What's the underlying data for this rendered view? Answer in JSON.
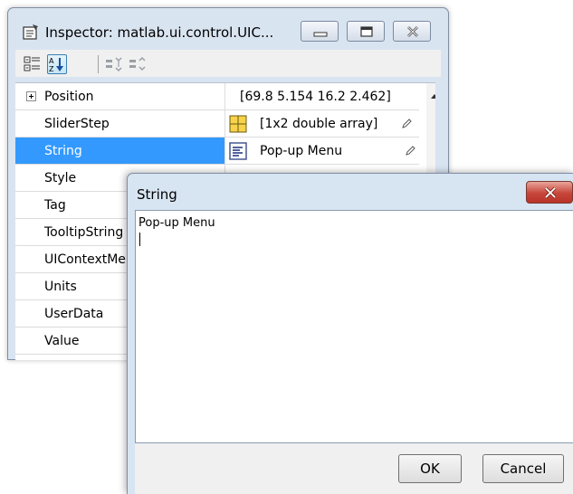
{
  "inspector": {
    "title": "Inspector:  matlab.ui.control.UIC...",
    "rows": [
      {
        "name": "Position",
        "value": "[69.8 5.154 16.2 2.462]"
      },
      {
        "name": "SliderStep",
        "value": "[1x2  double array]"
      },
      {
        "name": "String",
        "value": "Pop-up Menu"
      },
      {
        "name": "Style",
        "value": ""
      },
      {
        "name": "Tag",
        "value": ""
      },
      {
        "name": "TooltipString",
        "value": ""
      },
      {
        "name": "UIContextMenu",
        "value": ""
      },
      {
        "name": "Units",
        "value": ""
      },
      {
        "name": "UserData",
        "value": ""
      },
      {
        "name": "Value",
        "value": ""
      }
    ]
  },
  "dialog": {
    "title": "String",
    "text": "Pop-up Menu",
    "ok_label": "OK",
    "cancel_label": "Cancel"
  },
  "icons": {
    "inspector": "inspector-app-icon",
    "categorized": "categorized-view-icon",
    "alphabetical": "sort-alphabetical-icon",
    "expand_all": "expand-all-icon",
    "collapse_all": "collapse-all-icon",
    "array_editor": "array-editor-icon",
    "text_editor": "text-editor-icon"
  },
  "colors": {
    "selection": "#3399ff",
    "window_frame": "#d9e4f1",
    "close_button": "#c7453a"
  }
}
